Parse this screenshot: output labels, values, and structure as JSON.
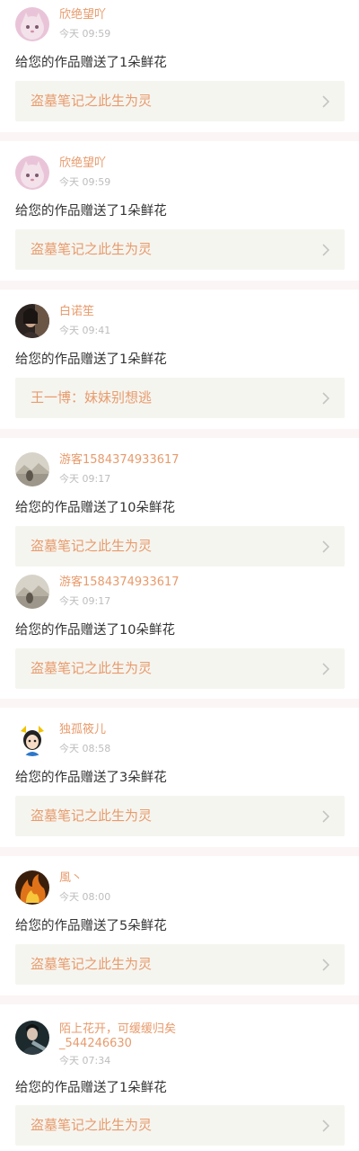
{
  "items": [
    {
      "username": "欣绝望吖",
      "time": "今天 09:59",
      "message": "给您的作品赠送了1朵鲜花",
      "work_title": "盗墓笔记之此生为灵",
      "avatar": "cat-avatar"
    },
    {
      "username": "欣绝望吖",
      "time": "今天 09:59",
      "message": "给您的作品赠送了1朵鲜花",
      "work_title": "盗墓笔记之此生为灵",
      "avatar": "cat-avatar"
    },
    {
      "username": "白诺笙",
      "time": "今天 09:41",
      "message": "给您的作品赠送了1朵鲜花",
      "work_title": "王一博：妹妹别想逃",
      "avatar": "dark-portrait-avatar"
    },
    {
      "username": "游客1584374933617",
      "time": "今天 09:17",
      "message": "给您的作品赠送了10朵鲜花",
      "work_title": "盗墓笔记之此生为灵",
      "avatar": "landscape-avatar"
    },
    {
      "username": "游客1584374933617",
      "time": "今天 09:17",
      "message": "给您的作品赠送了10朵鲜花",
      "work_title": "盗墓笔记之此生为灵",
      "avatar": "landscape-avatar"
    },
    {
      "username": "独孤筱儿",
      "time": "今天 08:58",
      "message": "给您的作品赠送了3朵鲜花",
      "work_title": "盗墓笔记之此生为灵",
      "avatar": "cartoon-avatar"
    },
    {
      "username": "風丶",
      "time": "今天 08:00",
      "message": "给您的作品赠送了5朵鲜花",
      "work_title": "盗墓笔记之此生为灵",
      "avatar": "fire-avatar"
    },
    {
      "username": "陌上花开，可缓缓归矣_544246630",
      "time": "今天 07:34",
      "message": "给您的作品赠送了1朵鲜花",
      "work_title": "盗墓笔记之此生为灵",
      "avatar": "dark-figure-avatar"
    }
  ],
  "colors": {
    "accent": "#e89b6c",
    "time": "#bdbdbd",
    "message": "#333333",
    "card_bg": "#f5f5f0",
    "divider": "#fbf5f5"
  }
}
